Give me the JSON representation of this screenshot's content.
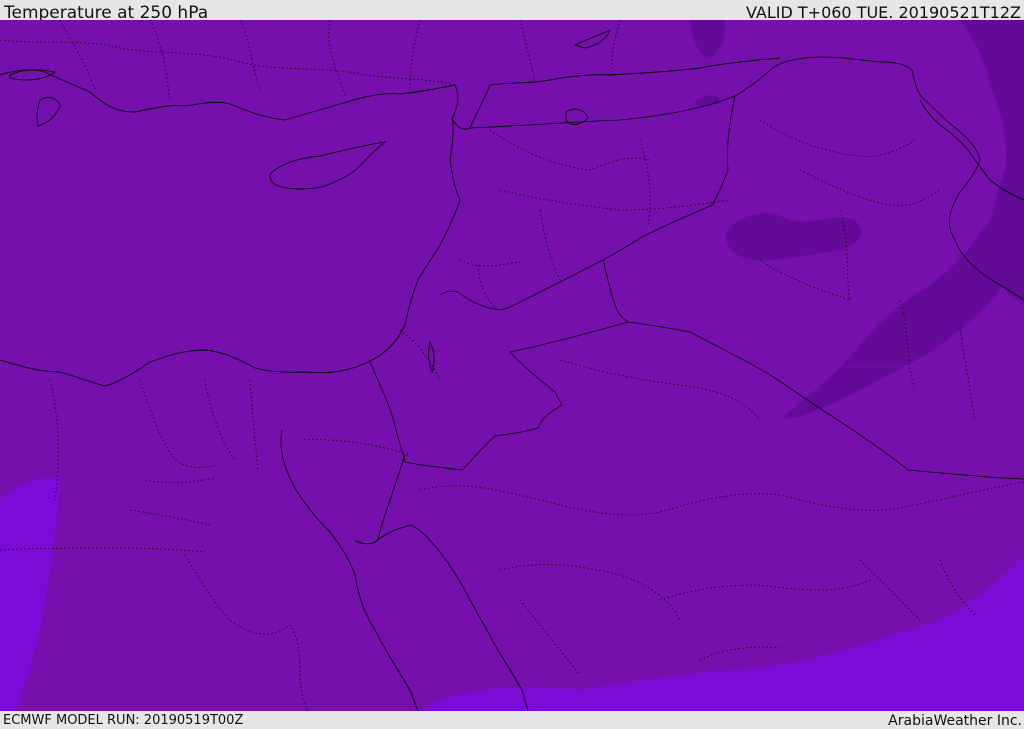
{
  "header": {
    "title": "Temperature at 250 hPa",
    "valid_time": "VALID T+060 TUE. 20190521T12Z"
  },
  "footer": {
    "model_run": "ECMWF MODEL RUN: 20190519T00Z",
    "credit": "ArabiaWeather Inc."
  },
  "map": {
    "field": "temperature",
    "level": "250 hPa",
    "colors": {
      "base": "#7610ad",
      "darker_band": "#6a0aa0",
      "cooler_edge": "#7e0dd8",
      "boundary_line": "#000000"
    }
  }
}
